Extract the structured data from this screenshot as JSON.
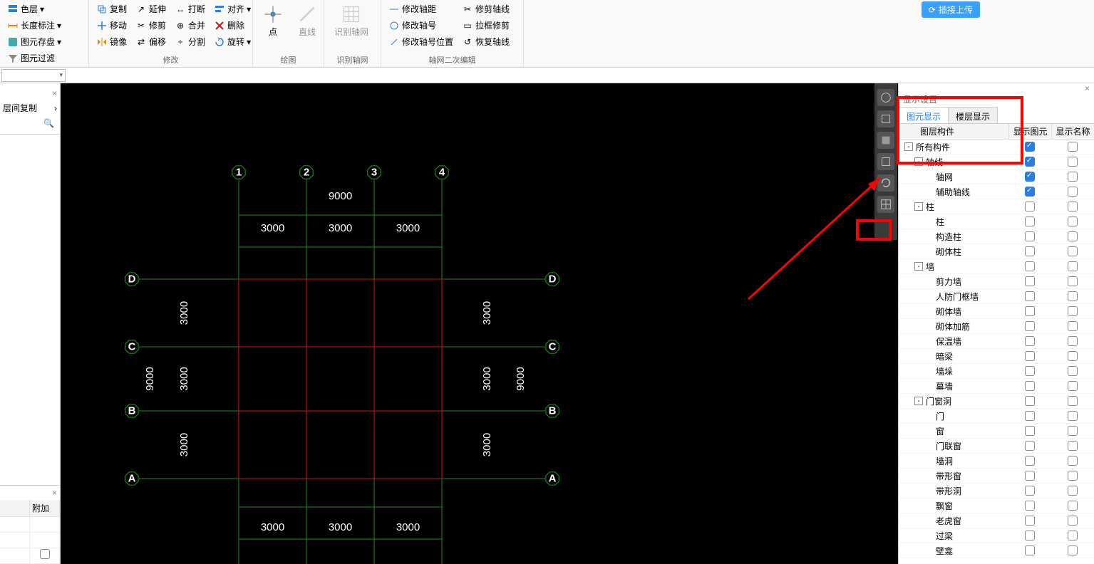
{
  "ribbon": {
    "g1": {
      "itemA": "色层",
      "itemB": "层间复制",
      "b1": "长度标注",
      "b2": "图元存盘",
      "b3": "图元过滤"
    },
    "g2": {
      "label": "修改",
      "copy": "复制",
      "move": "移动",
      "mirror": "镜像",
      "extend": "延伸",
      "trim": "修剪",
      "offset": "偏移",
      "stretch": "打断",
      "merge": "合并",
      "split": "分割",
      "align": "对齐",
      "delete": "删除",
      "rotate": "旋转"
    },
    "g3": {
      "label": "绘图",
      "pt": "点",
      "line": "直线",
      "grid": "识别轴网"
    },
    "g4": {
      "label": "识别轴网"
    },
    "g5": {
      "label": "轴网二次编辑",
      "a": "修改轴距",
      "b": "修改轴号",
      "c": "修改轴号位置",
      "d": "修剪轴线",
      "e": "拉框修剪",
      "f": "恢复轴线"
    }
  },
  "upload_label": "插接上传",
  "left": {
    "copy": "层间复制",
    "more": "›",
    "attach": "附加"
  },
  "canvas": {
    "cols": [
      "1",
      "2",
      "3",
      "4"
    ],
    "rows": [
      "A",
      "B",
      "C",
      "D"
    ],
    "hdims": [
      "3000",
      "3000",
      "3000"
    ],
    "htotal": "9000",
    "vdims": [
      "3000",
      "3000",
      "3000"
    ],
    "vtotal": "9000"
  },
  "right": {
    "title": "显示设置",
    "tab1": "图元显示",
    "tab2": "楼层显示",
    "h1": "图层构件",
    "h2": "显示图元",
    "h3": "显示名称",
    "tree": [
      {
        "ind": 0,
        "exp": "-",
        "name": "所有构件",
        "c1": true,
        "c2": false
      },
      {
        "ind": 1,
        "exp": "-",
        "name": "轴线",
        "c1": true,
        "c2": false
      },
      {
        "ind": 2,
        "exp": "",
        "name": "轴网",
        "c1": true,
        "c2": false
      },
      {
        "ind": 2,
        "exp": "",
        "name": "辅助轴线",
        "c1": true,
        "c2": false
      },
      {
        "ind": 1,
        "exp": "-",
        "name": "柱",
        "c1": false,
        "c2": false
      },
      {
        "ind": 2,
        "exp": "",
        "name": "柱",
        "c1": false,
        "c2": false
      },
      {
        "ind": 2,
        "exp": "",
        "name": "构造柱",
        "c1": false,
        "c2": false
      },
      {
        "ind": 2,
        "exp": "",
        "name": "砌体柱",
        "c1": false,
        "c2": false
      },
      {
        "ind": 1,
        "exp": "-",
        "name": "墙",
        "c1": false,
        "c2": false
      },
      {
        "ind": 2,
        "exp": "",
        "name": "剪力墙",
        "c1": false,
        "c2": false
      },
      {
        "ind": 2,
        "exp": "",
        "name": "人防门框墙",
        "c1": false,
        "c2": false
      },
      {
        "ind": 2,
        "exp": "",
        "name": "砌体墙",
        "c1": false,
        "c2": false
      },
      {
        "ind": 2,
        "exp": "",
        "name": "砌体加筋",
        "c1": false,
        "c2": false
      },
      {
        "ind": 2,
        "exp": "",
        "name": "保温墙",
        "c1": false,
        "c2": false
      },
      {
        "ind": 2,
        "exp": "",
        "name": "暗梁",
        "c1": false,
        "c2": false
      },
      {
        "ind": 2,
        "exp": "",
        "name": "墙垛",
        "c1": false,
        "c2": false
      },
      {
        "ind": 2,
        "exp": "",
        "name": "幕墙",
        "c1": false,
        "c2": false
      },
      {
        "ind": 1,
        "exp": "-",
        "name": "门窗洞",
        "c1": false,
        "c2": false
      },
      {
        "ind": 2,
        "exp": "",
        "name": "门",
        "c1": false,
        "c2": false
      },
      {
        "ind": 2,
        "exp": "",
        "name": "窗",
        "c1": false,
        "c2": false
      },
      {
        "ind": 2,
        "exp": "",
        "name": "门联窗",
        "c1": false,
        "c2": false
      },
      {
        "ind": 2,
        "exp": "",
        "name": "墙洞",
        "c1": false,
        "c2": false
      },
      {
        "ind": 2,
        "exp": "",
        "name": "带形窗",
        "c1": false,
        "c2": false
      },
      {
        "ind": 2,
        "exp": "",
        "name": "带形洞",
        "c1": false,
        "c2": false
      },
      {
        "ind": 2,
        "exp": "",
        "name": "飘窗",
        "c1": false,
        "c2": false
      },
      {
        "ind": 2,
        "exp": "",
        "name": "老虎窗",
        "c1": false,
        "c2": false
      },
      {
        "ind": 2,
        "exp": "",
        "name": "过梁",
        "c1": false,
        "c2": false
      },
      {
        "ind": 2,
        "exp": "",
        "name": "壁龛",
        "c1": false,
        "c2": false
      }
    ]
  }
}
